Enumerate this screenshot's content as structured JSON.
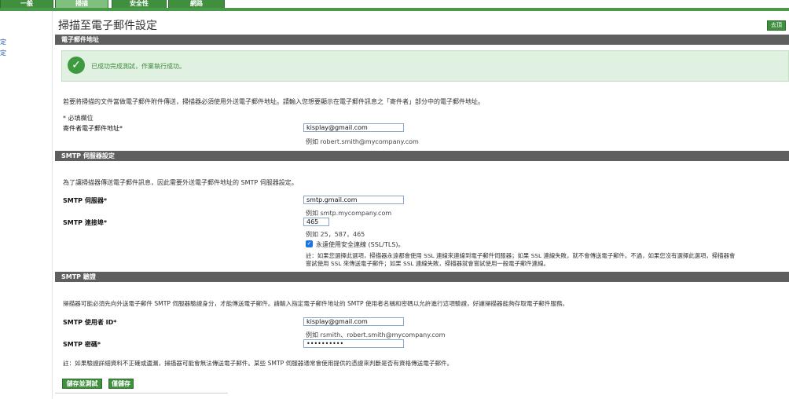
{
  "tabs": [
    {
      "label": "一般"
    },
    {
      "label": "掃描"
    },
    {
      "label": "安全性"
    },
    {
      "label": "網路"
    }
  ],
  "leftnav": {
    "items": [
      "定",
      "定"
    ]
  },
  "page": {
    "title": "掃描至電子郵件設定",
    "top_button": "去頂"
  },
  "email_section": {
    "header": "電子郵件地址",
    "success_message": "已成功完成測試，作業執行成功。",
    "description": "若要將掃描的文件當做電子郵件附件傳送，掃描器必須使用外送電子郵件地址。請輸入您想要顯示在電子郵件訊息之「寄件者」部分中的電子郵件地址。",
    "required_note": "* 必填欄位",
    "sender_label": "寄件者電子郵件地址*",
    "sender_value": "kisplay@gmail.com",
    "sender_example": "例如 robert.smith@mycompany.com"
  },
  "smtp_section": {
    "header": "SMTP 伺服器設定",
    "description": "為了讓掃描器傳送電子郵件訊息，因此需要外送電子郵件地址的 SMTP 伺服器設定。",
    "server_label": "SMTP 伺服器*",
    "server_value": "smtp.gmail.com",
    "server_example": "例如 smtp.mycompany.com",
    "port_label": "SMTP 連接埠*",
    "port_value": "465",
    "port_example": "例如 25，587，465",
    "ssl_label": "永遠使用安全連線 (SSL/TLS)。",
    "ssl_checked": true,
    "ssl_note_1": "註：如果您選擇此選項，掃描器永遠都會使用 SSL 連線來連線到電子郵件伺服器；如果 SSL 連線失敗，就不會傳送電子郵件。不過，如果您沒有選擇此選項，掃描器會",
    "ssl_note_2": "嘗試使用 SSL 來傳送電子郵件；如果 SSL 連線失敗，掃描器就會嘗試使用一般電子郵件連線。"
  },
  "auth_section": {
    "header": "SMTP 驗證",
    "description": "掃描器可能必須先向外送電子郵件 SMTP 伺服器驗證身分，才能傳送電子郵件。請輸入指定電子郵件地址的 SMTP 使用者名稱和密碼以允許進行這項驗證，好讓掃描器能夠存取電子郵件服務。",
    "user_label": "SMTP 使用者 ID*",
    "user_value": "kisplay@gmail.com",
    "user_example": "例如 rsmith、robert.smith@mycompany.com",
    "password_label": "SMTP 密碼*",
    "password_value": "••••••••••",
    "note": "註：如果驗證詳細資料不正確或遺漏，掃描器可能會無法傳送電子郵件。某些 SMTP 伺服器通常會使用提供的憑證來判斷是否有資格傳送電子郵件。"
  },
  "buttons": {
    "save_test": "儲存並測試",
    "save": "僅儲存"
  },
  "colors": {
    "accent": "#3f8f3f",
    "section_header": "#5f5f5f",
    "success_bg": "#e1f1e1",
    "success_icon": "#3e9a3e"
  }
}
